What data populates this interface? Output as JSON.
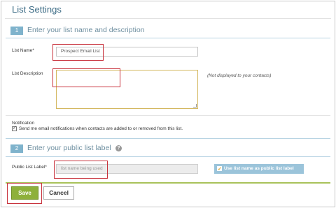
{
  "page": {
    "title": "List Settings"
  },
  "section1": {
    "number": "1",
    "heading": "Enter your list name and description"
  },
  "list_name": {
    "label": "List Name*",
    "value": "Prospect Email List"
  },
  "list_description": {
    "label": "List Description",
    "value": "",
    "note": "(Not displayed to your contacts)"
  },
  "notification": {
    "heading": "Notification",
    "checked": true,
    "text": "Send me email notifications when contacts are added to or removed from this list."
  },
  "section2": {
    "number": "2",
    "heading": "Enter your public list label",
    "help_icon": "question-circle-icon"
  },
  "public_label": {
    "label": "Public List Label*",
    "placeholder": "list name being used",
    "toggle_label": "Use list name as public list label",
    "toggle_checked": true
  },
  "actions": {
    "save": "Save",
    "cancel": "Cancel"
  },
  "colors": {
    "accent_green": "#8eb03a",
    "section_blue": "#7fb3cc",
    "highlight_red": "#c8323c"
  }
}
